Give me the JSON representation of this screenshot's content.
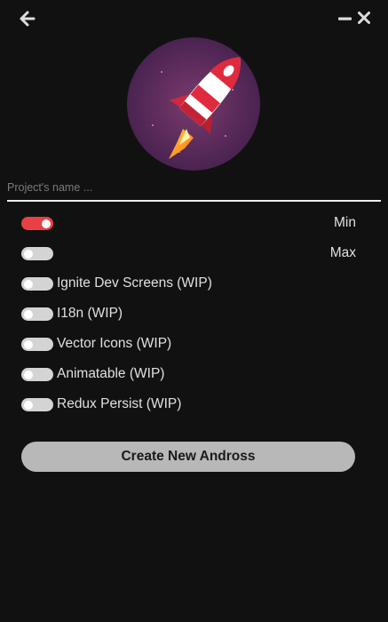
{
  "window": {
    "controls": {
      "back_icon": "arrow-left-icon",
      "minimize_icon": "minimize-icon",
      "close_icon": "close-icon"
    }
  },
  "logo": {
    "icon": "rocket-icon"
  },
  "project_name": {
    "value": "",
    "placeholder": "Project's name ..."
  },
  "options": [
    {
      "label": "Min",
      "on": true
    },
    {
      "label": "Max",
      "on": false
    },
    {
      "label": "Ignite Dev Screens (WIP)",
      "on": false
    },
    {
      "label": "I18n (WIP)",
      "on": false
    },
    {
      "label": "Vector Icons (WIP)",
      "on": false
    },
    {
      "label": "Animatable (WIP)",
      "on": false
    },
    {
      "label": "Redux Persist (WIP)",
      "on": false
    }
  ],
  "create_button": {
    "label": "Create New Andross"
  },
  "colors": {
    "background": "#111111",
    "accent": "#e84045",
    "toggle_off": "#d4d4d4",
    "button": "#b8b8b8"
  }
}
